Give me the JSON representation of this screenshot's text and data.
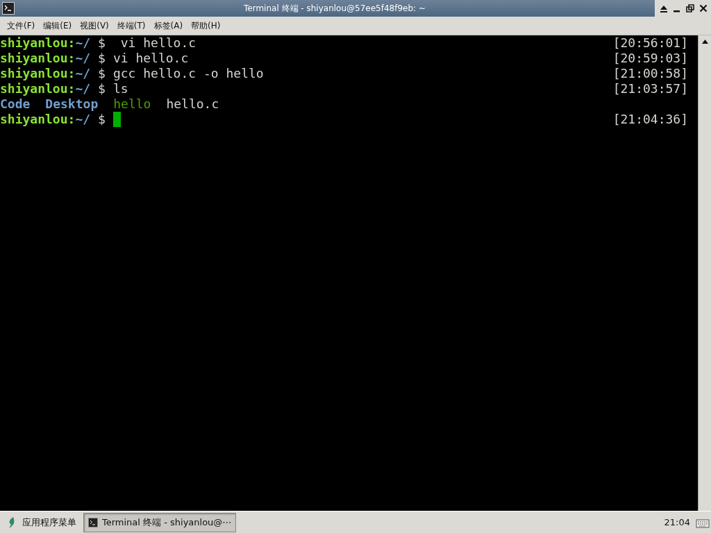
{
  "window": {
    "title": "Terminal 终端 - shiyanlou@57ee5f48f9eb: ~"
  },
  "menu": [
    {
      "label": "文件(F)"
    },
    {
      "label": "编辑(E)"
    },
    {
      "label": "视图(V)"
    },
    {
      "label": "终端(T)"
    },
    {
      "label": "标签(A)"
    },
    {
      "label": "帮助(H)"
    }
  ],
  "terminal": {
    "lines": [
      {
        "kind": "prompt",
        "user": "shiyanlou:",
        "path": "~/",
        "sign": "$",
        "command": " vi hello.c",
        "time": "[20:56:01]"
      },
      {
        "kind": "prompt",
        "user": "shiyanlou:",
        "path": "~/",
        "sign": "$",
        "command": "vi hello.c",
        "time": "[20:59:03]"
      },
      {
        "kind": "prompt",
        "user": "shiyanlou:",
        "path": "~/",
        "sign": "$",
        "command": "gcc hello.c -o hello",
        "time": "[21:00:58]"
      },
      {
        "kind": "prompt",
        "user": "shiyanlou:",
        "path": "~/",
        "sign": "$",
        "command": "ls",
        "time": "[21:03:57]"
      },
      {
        "kind": "listing",
        "entries": [
          {
            "name": "Code",
            "kind": "dir"
          },
          {
            "name": "Desktop",
            "kind": "dir"
          },
          {
            "name": "hello",
            "kind": "exec"
          },
          {
            "name": "hello.c",
            "kind": "file"
          }
        ]
      },
      {
        "kind": "input",
        "user": "shiyanlou:",
        "path": "~/",
        "sign": "$",
        "time": "[21:04:36]"
      }
    ]
  },
  "taskbar": {
    "app_menu": "应用程序菜单",
    "tasks": [
      {
        "label": "Terminal 终端 - shiyanlou@⋯",
        "selected": true
      }
    ],
    "clock": "21:04"
  }
}
